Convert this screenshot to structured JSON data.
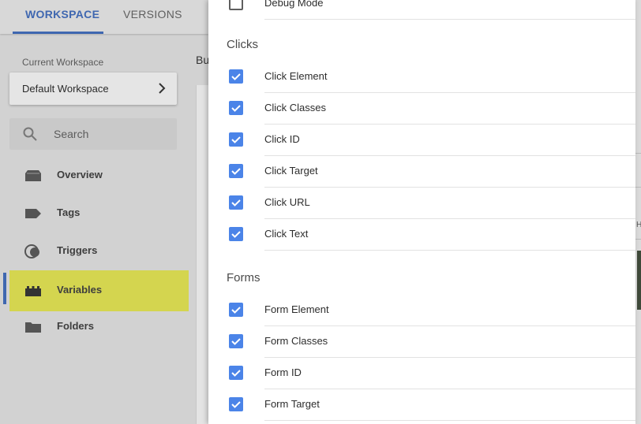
{
  "tabs": {
    "workspace": "WORKSPACE",
    "versions": "VERSIONS"
  },
  "workspace": {
    "caption": "Current Workspace",
    "name": "Default Workspace"
  },
  "search": {
    "placeholder": "Search"
  },
  "nav": {
    "overview": "Overview",
    "tags": "Tags",
    "triggers": "Triggers",
    "variables": "Variables",
    "folders": "Folders",
    "active": "Variables",
    "active_color": "#d4d54f"
  },
  "background_peek": "Bu",
  "drawer": {
    "top_row": {
      "label": "Debug Mode",
      "checked": false
    },
    "clicks": {
      "title": "Clicks",
      "items": [
        {
          "label": "Click Element",
          "checked": true
        },
        {
          "label": "Click Classes",
          "checked": true
        },
        {
          "label": "Click ID",
          "checked": true
        },
        {
          "label": "Click Target",
          "checked": true
        },
        {
          "label": "Click URL",
          "checked": true
        },
        {
          "label": "Click Text",
          "checked": true
        }
      ]
    },
    "forms": {
      "title": "Forms",
      "items": [
        {
          "label": "Form Element",
          "checked": true
        },
        {
          "label": "Form Classes",
          "checked": true
        },
        {
          "label": "Form ID",
          "checked": true
        },
        {
          "label": "Form Target",
          "checked": true
        }
      ]
    }
  },
  "right_edge_char": "H",
  "colors": {
    "accent": "#3f67b0",
    "checkbox": "#4b84e8"
  }
}
